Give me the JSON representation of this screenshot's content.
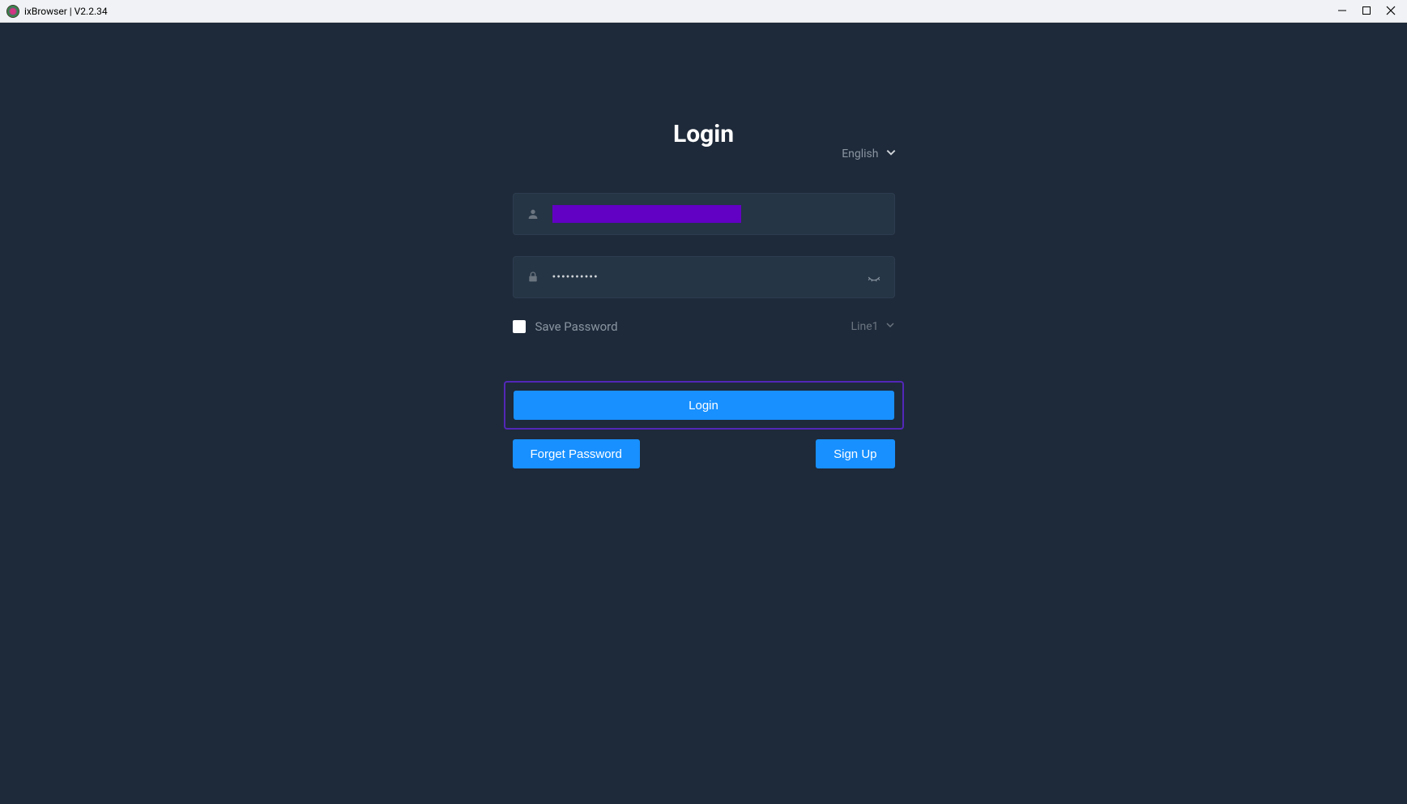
{
  "titlebar": {
    "app_title": "ixBrowser | V2.2.34"
  },
  "login": {
    "title": "Login",
    "language": "English",
    "username_redacted": true,
    "password_masked": "••••••••••",
    "save_password_label": "Save Password",
    "line_label": "Line1",
    "login_button": "Login",
    "forget_password_button": "Forget Password",
    "signup_button": "Sign Up"
  }
}
